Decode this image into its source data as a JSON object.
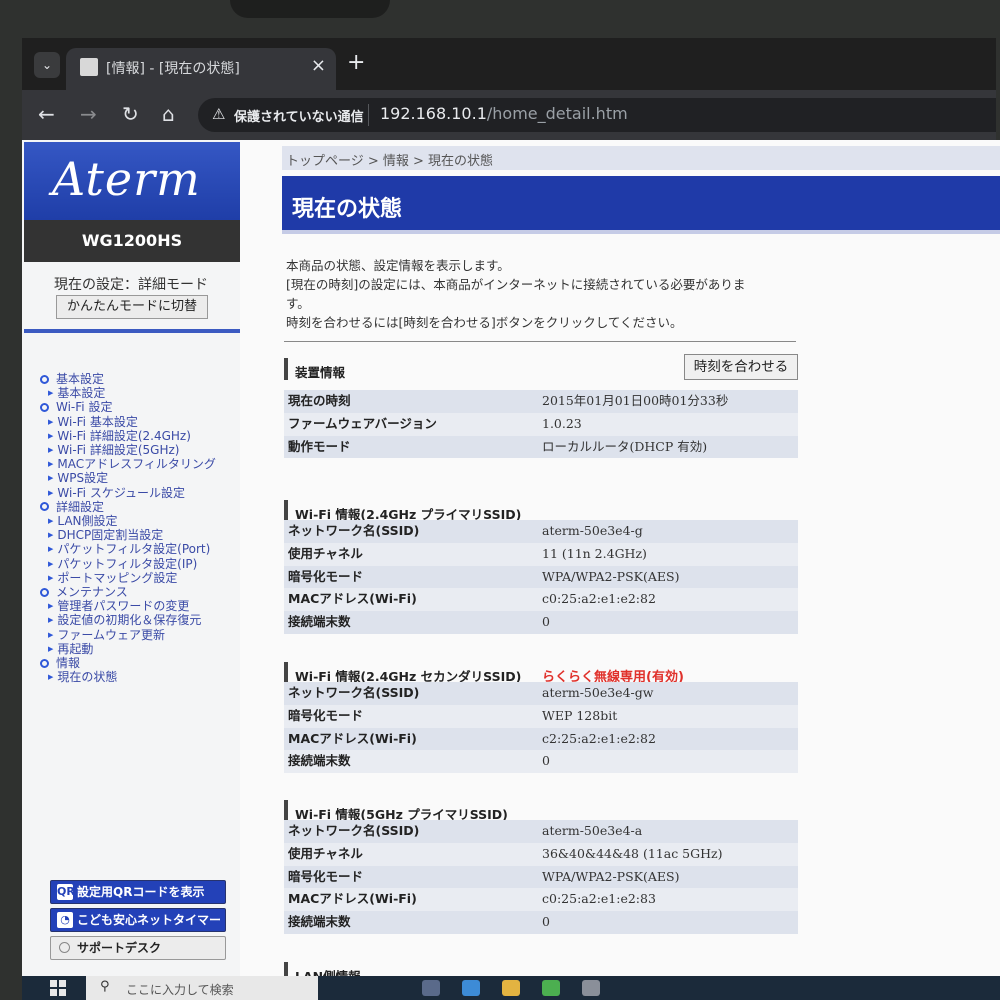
{
  "browser": {
    "tab_menu_icon": "chevron-down-icon",
    "tab_title": "[情報] - [現在の状態]",
    "tab_close": "×",
    "new_tab": "+",
    "back": "←",
    "forward": "→",
    "reload": "↻",
    "home": "⌂",
    "security_icon": "⚠",
    "security_text": "保護されていない通信",
    "url_host": "192.168.10.1",
    "url_path": "/home_detail.htm"
  },
  "sidebar": {
    "logo": "Aterm",
    "model": "WG1200HS",
    "mode_label": "現在の設定：詳細モード",
    "mode_button": "かんたんモードに切替",
    "menu": [
      {
        "label": "基本設定",
        "items": [
          "基本設定"
        ]
      },
      {
        "label": "Wi-Fi 設定",
        "items": [
          "Wi-Fi 基本設定",
          "Wi-Fi 詳細設定(2.4GHz)",
          "Wi-Fi 詳細設定(5GHz)",
          "MACアドレスフィルタリング",
          "WPS設定",
          "Wi-Fi スケジュール設定"
        ]
      },
      {
        "label": "詳細設定",
        "items": [
          "LAN側設定",
          "DHCP固定割当設定",
          "パケットフィルタ設定(Port)",
          "パケットフィルタ設定(IP)",
          "ポートマッピング設定"
        ]
      },
      {
        "label": "メンテナンス",
        "items": [
          "管理者パスワードの変更",
          "設定値の初期化＆保存復元",
          "ファームウェア更新",
          "再起動"
        ]
      },
      {
        "label": "情報",
        "items": [
          "現在の状態"
        ]
      }
    ],
    "qr_button": "設定用QRコードを表示",
    "qr_icon": "QR",
    "timer_button": "こども安心ネットタイマー",
    "timer_icon": "◔",
    "support_button": "サポートデスク"
  },
  "main": {
    "breadcrumb": "トップページ > 情報 > 現在の状態",
    "title": "現在の状態",
    "intro": [
      "本商品の状態、設定情報を表示します。",
      "[現在の時刻]の設定には、本商品がインターネットに接続されている必要がありま",
      "す。",
      "時刻を合わせるには[時刻を合わせる]ボタンをクリックしてください。"
    ],
    "sync_button": "時刻を合わせる",
    "sections": [
      {
        "title": "装置情報",
        "note": "",
        "rows": [
          {
            "k": "現在の時刻",
            "v": "2015年01月01日00時01分33秒"
          },
          {
            "k": "ファームウェアバージョン",
            "v": "1.0.23"
          },
          {
            "k": "動作モード",
            "v": "ローカルルータ(DHCP 有効)"
          }
        ]
      },
      {
        "title": "Wi-Fi 情報(2.4GHz プライマリSSID)",
        "note": "",
        "rows": [
          {
            "k": "ネットワーク名(SSID)",
            "v": "aterm-50e3e4-g"
          },
          {
            "k": "使用チャネル",
            "v": "11 (11n 2.4GHz)"
          },
          {
            "k": "暗号化モード",
            "v": "WPA/WPA2-PSK(AES)"
          },
          {
            "k": "MACアドレス(Wi-Fi)",
            "v": "c0:25:a2:e1:e2:82"
          },
          {
            "k": "接続端末数",
            "v": "0"
          }
        ]
      },
      {
        "title": "Wi-Fi 情報(2.4GHz セカンダリSSID)",
        "note": "らくらく無線専用(有効)",
        "rows": [
          {
            "k": "ネットワーク名(SSID)",
            "v": "aterm-50e3e4-gw"
          },
          {
            "k": "暗号化モード",
            "v": "WEP 128bit"
          },
          {
            "k": "MACアドレス(Wi-Fi)",
            "v": "c2:25:a2:e1:e2:82"
          },
          {
            "k": "接続端末数",
            "v": "0"
          }
        ]
      },
      {
        "title": "Wi-Fi 情報(5GHz プライマリSSID)",
        "note": "",
        "rows": [
          {
            "k": "ネットワーク名(SSID)",
            "v": "aterm-50e3e4-a"
          },
          {
            "k": "使用チャネル",
            "v": "36&40&44&48 (11ac 5GHz)"
          },
          {
            "k": "暗号化モード",
            "v": "WPA/WPA2-PSK(AES)"
          },
          {
            "k": "MACアドレス(Wi-Fi)",
            "v": "c0:25:a2:e1:e2:83"
          },
          {
            "k": "接続端末数",
            "v": "0"
          }
        ]
      },
      {
        "title": "LAN側情報",
        "note": "",
        "rows": []
      }
    ]
  },
  "taskbar": {
    "start_icon": "windows-icon",
    "search_icon": "⚲",
    "search_placeholder": "ここに入力して検索"
  }
}
